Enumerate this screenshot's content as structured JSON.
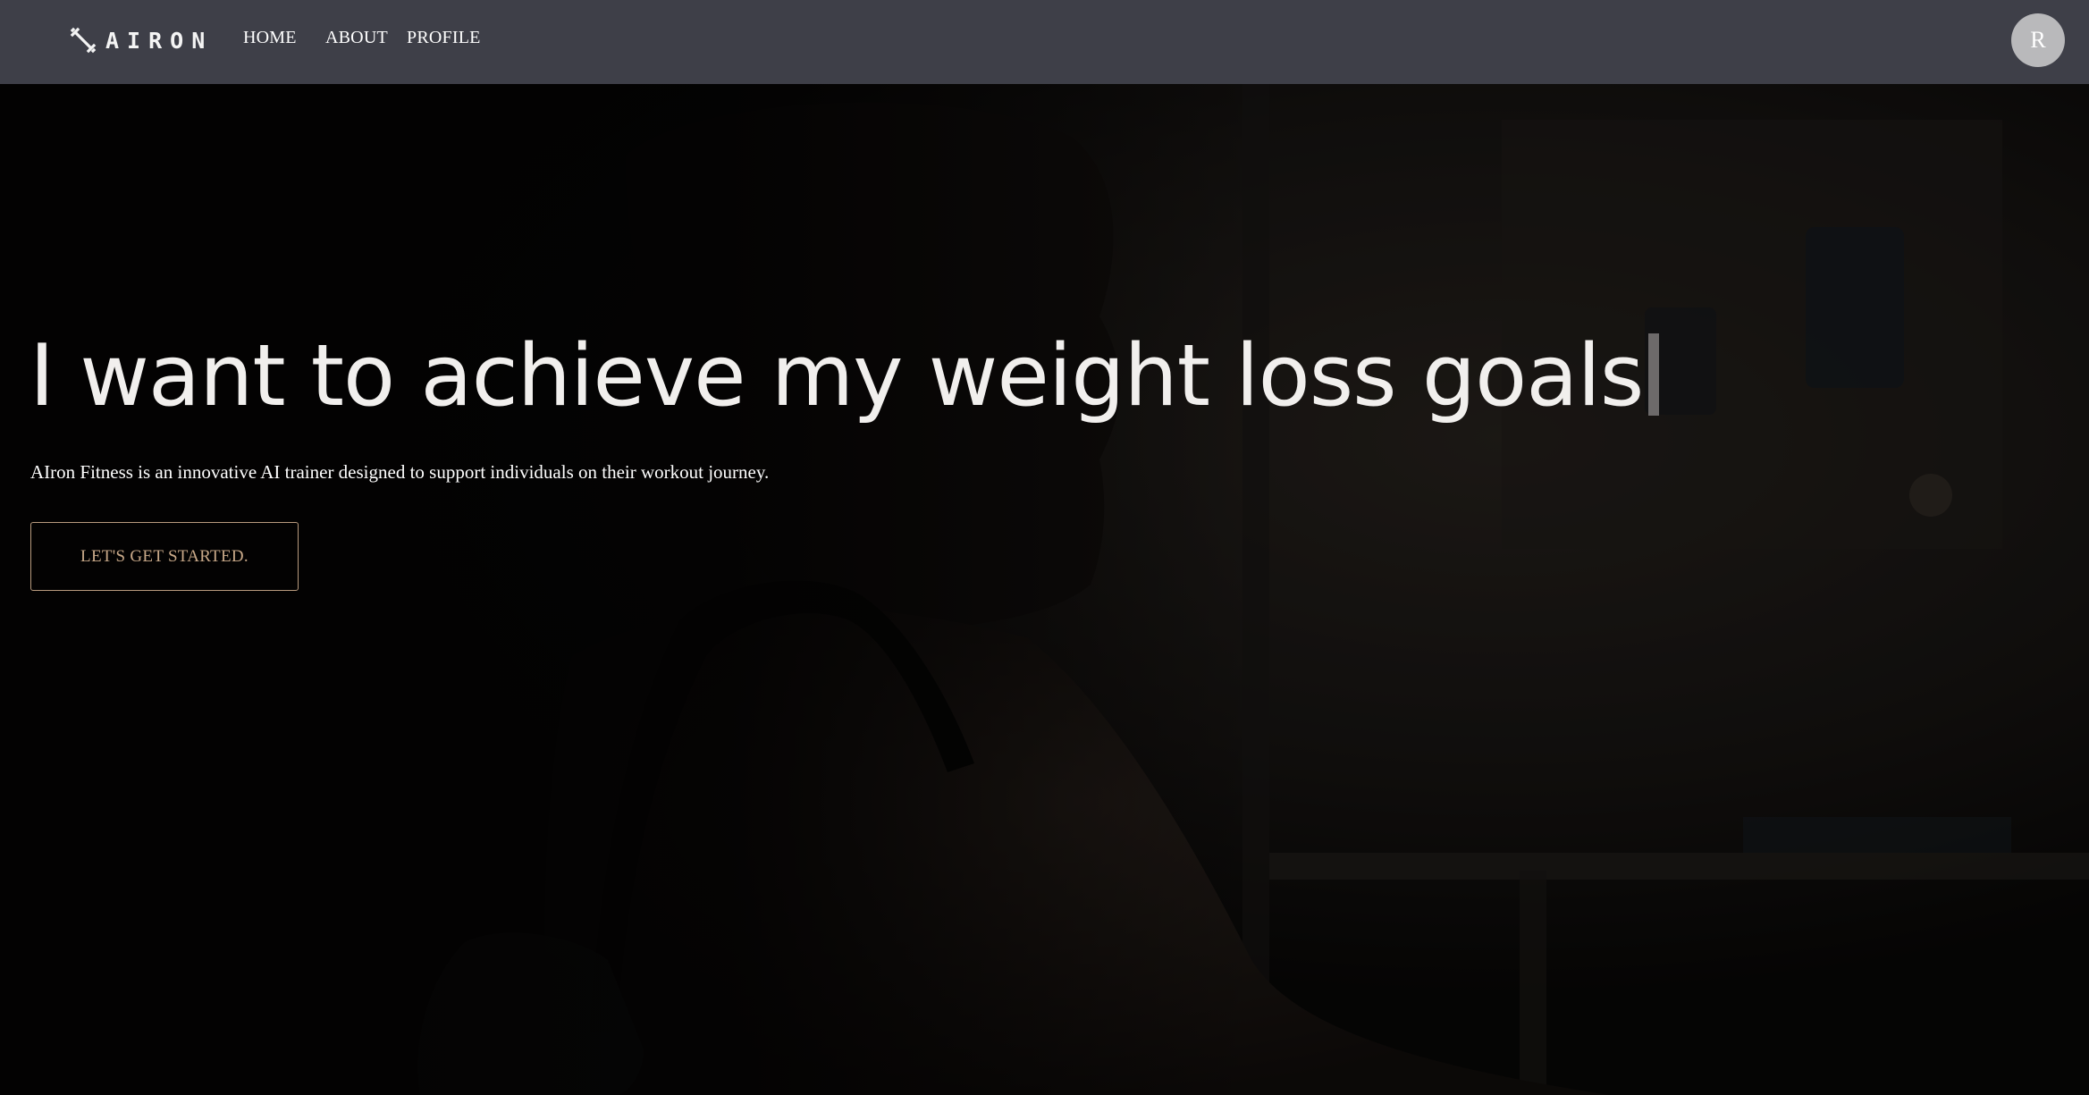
{
  "nav": {
    "logo_text": "AIRON",
    "logo_icon": "dumbbell-icon",
    "links": [
      "HOME",
      "ABOUT",
      "PROFILE"
    ],
    "avatar_initial": "R"
  },
  "hero": {
    "headline": "I want to achieve my weight loss goals",
    "subtitle": "AIron Fitness is an innovative AI trainer designed to support individuals on their workout journey.",
    "cta_label": "LET'S GET STARTED.",
    "background": "dark gym photo of a man in a tank top"
  },
  "colors": {
    "navbar_bg": "#3e3f48",
    "hero_text": "#f1efed",
    "cta_accent": "#c9a989",
    "avatar_bg": "#b9b9bb"
  }
}
